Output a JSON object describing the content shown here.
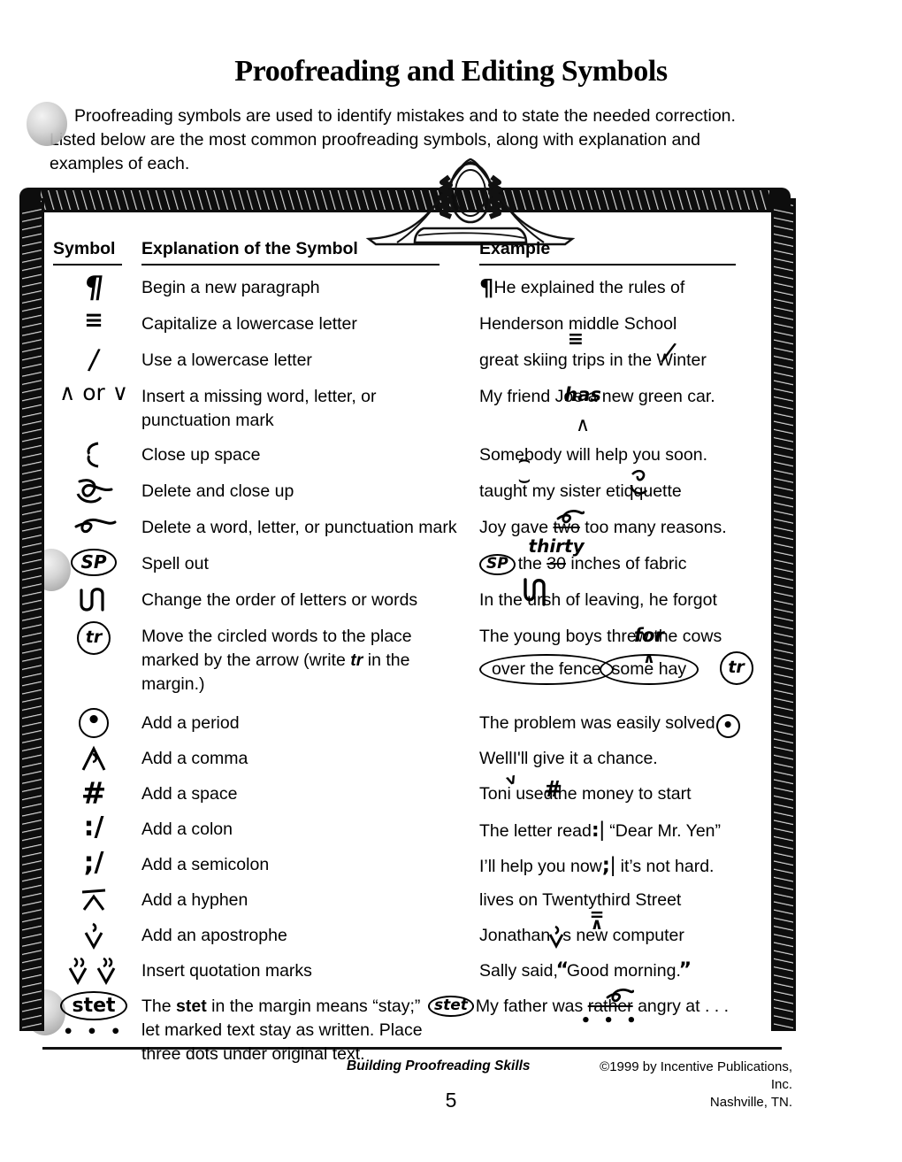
{
  "page_title": "Proofreading and Editing Symbols",
  "intro": {
    "line1": "Proofreading symbols are used to identify mistakes and to state the needed correction.",
    "line2": "Listed below are the most common proofreading symbols, along with explanation and",
    "line3": "examples of each."
  },
  "table": {
    "headers": {
      "symbol": "Symbol",
      "explanation": "Explanation of the Symbol",
      "example": "Example"
    },
    "rows": [
      {
        "symbol": "¶",
        "symbol_name": "pilcrow-new-paragraph",
        "explanation": "Begin a new paragraph",
        "example": "He explained the rules of",
        "mark": "¶"
      },
      {
        "symbol": "≡",
        "symbol_name": "triple-underline-capitalize",
        "explanation": "Capitalize a lowercase letter",
        "example_a": "Henderson ",
        "example_b": "m",
        "example_c": "iddle School",
        "mark": "≡"
      },
      {
        "symbol": "/",
        "symbol_name": "slash-lowercase",
        "explanation": "Use a lowercase letter",
        "example_a": "great skiing trips in the ",
        "example_b": "W",
        "example_c": "inter",
        "mark": "/"
      },
      {
        "symbol": "∧ or ∨",
        "symbol_name": "caret-insert",
        "explanation_line1": "Insert a missing word, letter, or",
        "explanation_line2": "punctuation mark",
        "example_a": "My friend Joe",
        "example_b": " a new green car.",
        "insert_word": "has",
        "mark": "∧"
      },
      {
        "symbol": "⊂⊃",
        "symbol_name": "close-up-space",
        "explanation": "Close up space",
        "example_a": "Some",
        "example_b": "body will help you soon.",
        "mark_top": "⌢",
        "mark_bottom": "⌣"
      },
      {
        "symbol": "ℎ",
        "symbol_name": "delete-and-close-up",
        "explanation": "Delete and close up",
        "example_a": "taught my sister etiq",
        "example_b": "q",
        "example_c": "uette"
      },
      {
        "symbol": "ℓ",
        "symbol_name": "delete-word",
        "explanation": "Delete a word, letter, or punctuation mark",
        "example_a": "Joy gave ",
        "example_b": "two",
        "example_c": " too many reasons."
      },
      {
        "symbol": "SP",
        "symbol_name": "spell-out-circle",
        "explanation": "Spell out",
        "example_a": "the ",
        "example_b": "30",
        "example_c": " inches of fabric",
        "insert_word": "thirty",
        "circle_label": "SP"
      },
      {
        "symbol": "∪∩",
        "symbol_name": "transpose-order",
        "explanation": "Change the order of letters or words",
        "example_a": "In the ",
        "example_b": "ur",
        "example_c": "sh of leaving, he forgot"
      },
      {
        "symbol": "tr",
        "symbol_name": "move-circled-words",
        "explanation_line1": "Move the circled words to the place",
        "explanation_line2a": "marked by the arrow (write ",
        "explanation_line2b": "tr",
        "explanation_line2c": " in the",
        "explanation_line3": "margin.)",
        "example_line1a": "The young boys threw",
        "example_line1b": " the cows",
        "example_circle1": "over the fence",
        "example_circle2": "some hay",
        "insert_word": "for",
        "circle_label": "tr"
      },
      {
        "symbol": "⊙",
        "symbol_name": "add-period",
        "explanation": "Add a period",
        "example": "The problem was easily solved",
        "mark": "⊙"
      },
      {
        "symbol": "∧",
        "symbol_name": "add-comma",
        "explanation": "Add a comma",
        "example_a": "Well",
        "example_b": "I'll give it a chance.",
        "mark": "ⱽ"
      },
      {
        "symbol": "#",
        "symbol_name": "add-space",
        "explanation": "Add a space",
        "example_a": "Toni used",
        "example_b": "the money to start",
        "mark": "#"
      },
      {
        "symbol": ":/",
        "symbol_name": "add-colon",
        "explanation": "Add a colon",
        "example_a": "The letter read",
        "example_b": "“Dear Mr. Yen”",
        "mark": ":"
      },
      {
        "symbol": ";/",
        "symbol_name": "add-semicolon",
        "explanation": "Add a semicolon",
        "example_a": "I’ll help you now",
        "example_b": "it’s not hard.",
        "mark": ";"
      },
      {
        "symbol": "̅∧",
        "symbol_name": "add-hyphen",
        "explanation": "Add a hyphen",
        "example_a": "lives on Twenty",
        "example_b": "third Street",
        "mark": "="
      },
      {
        "symbol": "ⱽ",
        "symbol_name": "add-apostrophe",
        "explanation": "Add an apostrophe",
        "example_a": "Jonathan",
        "example_b": "s new computer",
        "mark": "’"
      },
      {
        "symbol": "ⱽ ⱽ",
        "symbol_name": "insert-quotation-marks",
        "explanation": "Insert quotation marks",
        "example_a": "Sally said,",
        "example_b": "Good morning.",
        "mark_open": "“",
        "mark_close": "”"
      },
      {
        "symbol": "stet",
        "symbol_name": "stet-symbol",
        "explanation_line1a": "The ",
        "explanation_line1b": "stet",
        "explanation_line1c": " in the margin means “stay;”",
        "explanation_line2": "let marked text stay as written. Place",
        "explanation_line3": "three dots under original text.",
        "example_a": "My father was ",
        "example_b": "rather",
        "example_c": " angry at . . .",
        "circle_label": "stet",
        "dots": "• • •"
      }
    ]
  },
  "footer": {
    "book_title": "Building Proofreading Skills",
    "copyright_line1": "©1999 by Incentive Publications, Inc.",
    "copyright_line2": "Nashville, TN.",
    "page_number": "5"
  }
}
